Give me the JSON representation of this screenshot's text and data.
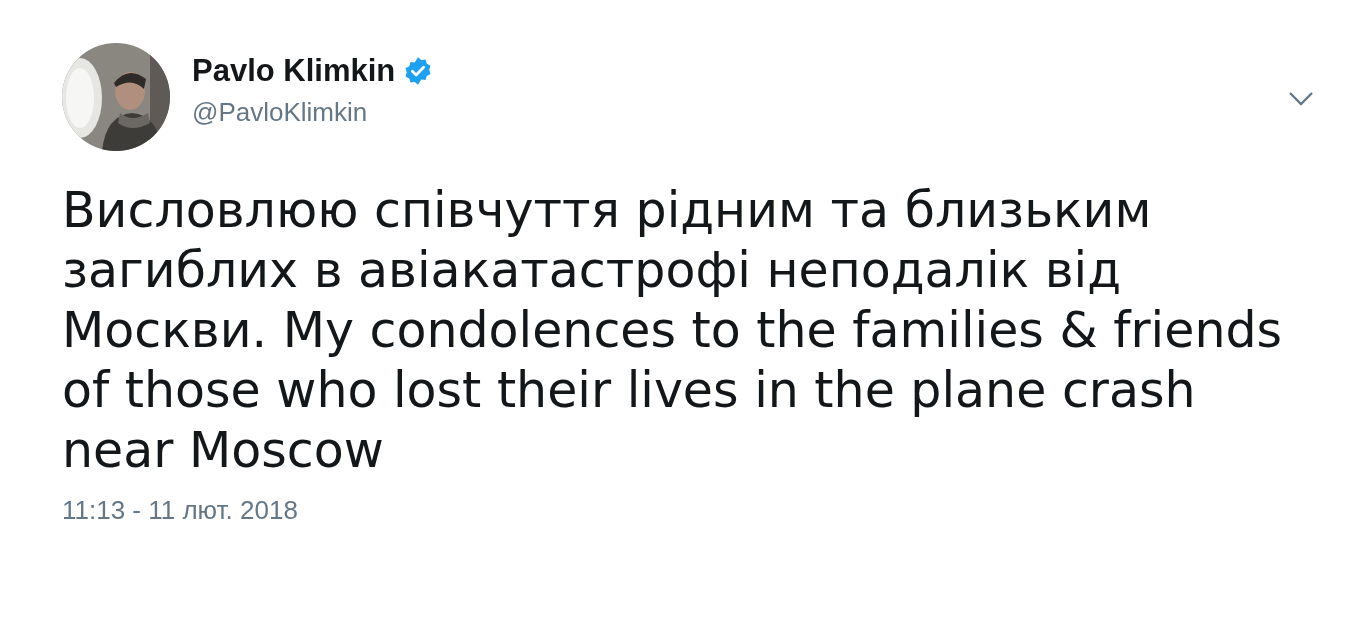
{
  "author": {
    "name": "Pavlo Klimkin",
    "verified": true,
    "handle": "@PavloKlimkin"
  },
  "text": "Висловлюю співчуття рідним та близьким загиблих в авіакатастрофі неподалік від Москви. My condolences to the families & friends of those who lost their lives in the plane crash near Moscow",
  "timestamp": "11:13 - 11 лют. 2018"
}
